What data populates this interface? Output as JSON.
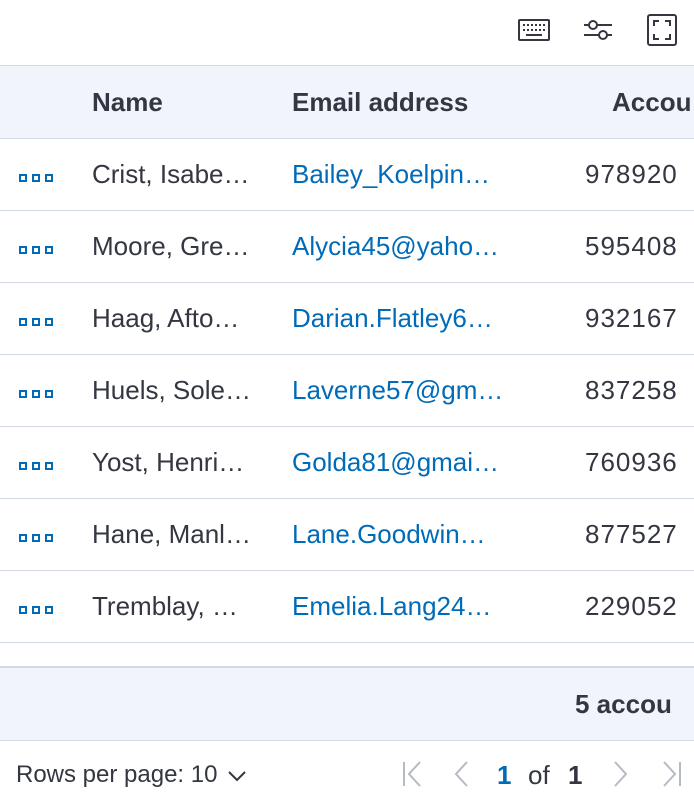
{
  "columns": {
    "name": "Name",
    "email": "Email address",
    "account": "Accou"
  },
  "rows": [
    {
      "name": "Crist, Isabe…",
      "email": "Bailey_Koelpin…",
      "account": "978920"
    },
    {
      "name": "Moore, Gre…",
      "email": "Alycia45@yaho…",
      "account": "595408"
    },
    {
      "name": "Haag, Afto…",
      "email": "Darian.Flatley6…",
      "account": "932167"
    },
    {
      "name": "Huels, Sole…",
      "email": "Laverne57@gm…",
      "account": "837258"
    },
    {
      "name": "Yost, Henri…",
      "email": "Golda81@gmai…",
      "account": "760936"
    },
    {
      "name": "Hane, Manl…",
      "email": "Lane.Goodwin…",
      "account": "877527"
    },
    {
      "name": "Tremblay, …",
      "email": "Emelia.Lang24…",
      "account": "229052"
    }
  ],
  "footer": {
    "summary": "5 accou"
  },
  "pagination": {
    "rows_per_page_label": "Rows per page: 10",
    "current_page": "1",
    "of_label": "of",
    "total_pages": "1"
  },
  "icons": {
    "toolbar": [
      "keyboard-icon",
      "options-icon",
      "fullscreen-icon"
    ],
    "row_action": "actions-icon"
  },
  "colors": {
    "link": "#006bb8",
    "header_bg": "#f1f4fa",
    "border": "#d3dae6",
    "text": "#343741"
  }
}
